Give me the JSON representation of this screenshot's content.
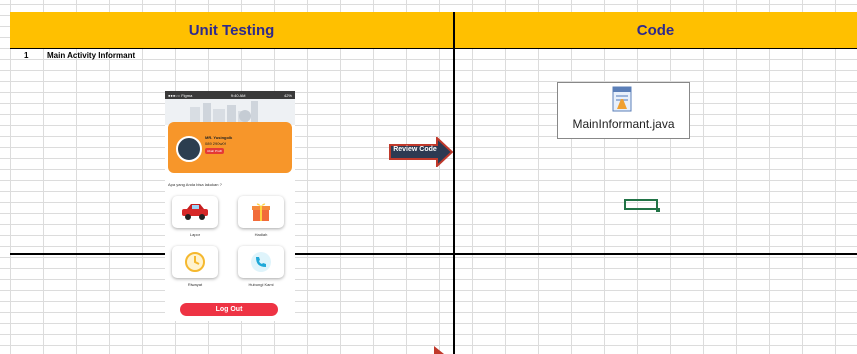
{
  "headers": {
    "left": "Unit Testing",
    "right": "Code"
  },
  "row": {
    "number": "1",
    "title": "Main Activity Informant"
  },
  "phone": {
    "status_left": "●●●○○ Figma",
    "status_time": "9:40 AM",
    "status_right": "42%",
    "user_name": "MR. Yusingolk",
    "user_id": "089 290w0f",
    "profile_badge": "Ubah Profil",
    "question": "Apa yang Anda bisa lakukan ?",
    "menu": [
      "Lapor",
      "Hadiah",
      "Riwayat",
      "Hubungi Kami"
    ],
    "logout": "Log Out"
  },
  "review_button": "Review Code",
  "file": {
    "name": "MainInformant.java"
  },
  "colors": {
    "header_bg": "#ffc000",
    "header_text": "#2f2a8c",
    "arrow": "#c0392b",
    "arrow_body": "#2d3a52",
    "logout": "#ee3344",
    "card": "#f7962a"
  }
}
